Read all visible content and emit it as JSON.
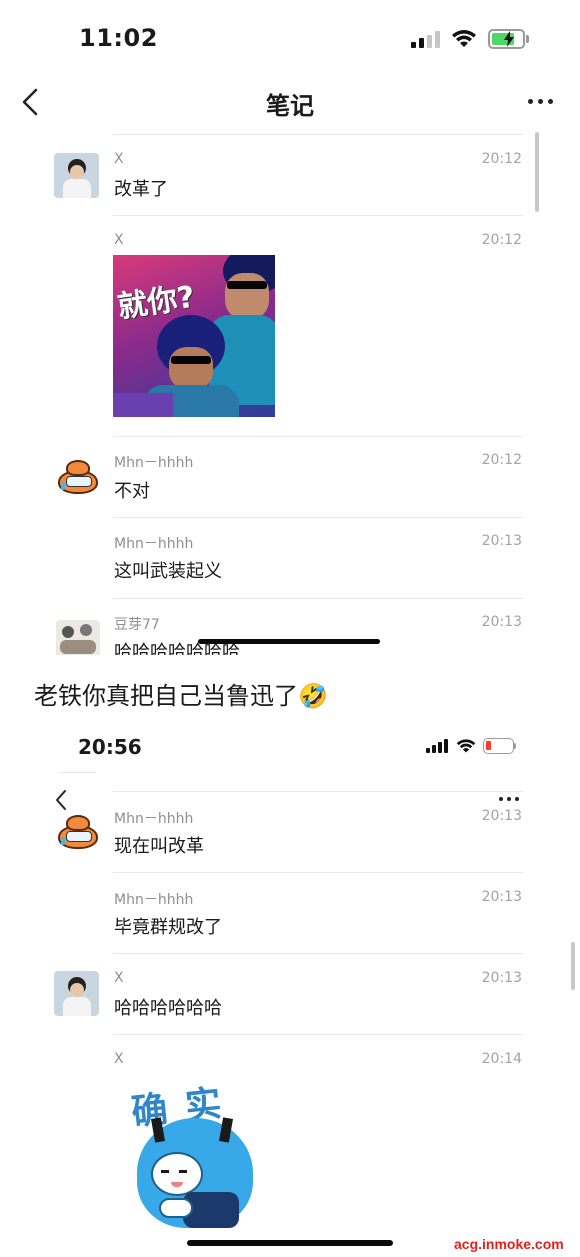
{
  "status_top": {
    "time": "11:02"
  },
  "nav": {
    "title": "笔记"
  },
  "messages_top": [
    {
      "sender": "X",
      "time": "20:12",
      "text": "改革了"
    },
    {
      "sender": "X",
      "time": "20:12",
      "image_text": "就你?"
    },
    {
      "sender": "Mhn－hhhh",
      "time": "20:12",
      "text": "不对"
    },
    {
      "sender": "Mhn－hhhh",
      "time": "20:13",
      "text": "这叫武装起义"
    },
    {
      "sender": "豆芽77",
      "time": "20:13",
      "text": "哈哈哈哈哈哈哈"
    }
  ],
  "caption": {
    "text": "老铁你真把自己当鲁迅了🤣"
  },
  "status_bottom": {
    "time": "20:56"
  },
  "messages_bottom": [
    {
      "sender": "Mhn－hhhh",
      "time": "20:13",
      "text": "现在叫改革"
    },
    {
      "sender": "Mhn－hhhh",
      "time": "20:13",
      "text": "毕竟群规改了"
    },
    {
      "sender": "X",
      "time": "20:13",
      "text": "哈哈哈哈哈哈"
    },
    {
      "sender": "X",
      "time": "20:14",
      "image_text": "确实"
    }
  ],
  "watermark": {
    "text": "acg.inmoke.com"
  },
  "colors": {
    "watermark": "#e0211b",
    "battery_green": "#4cd964",
    "battery_red": "#ff3b30"
  }
}
